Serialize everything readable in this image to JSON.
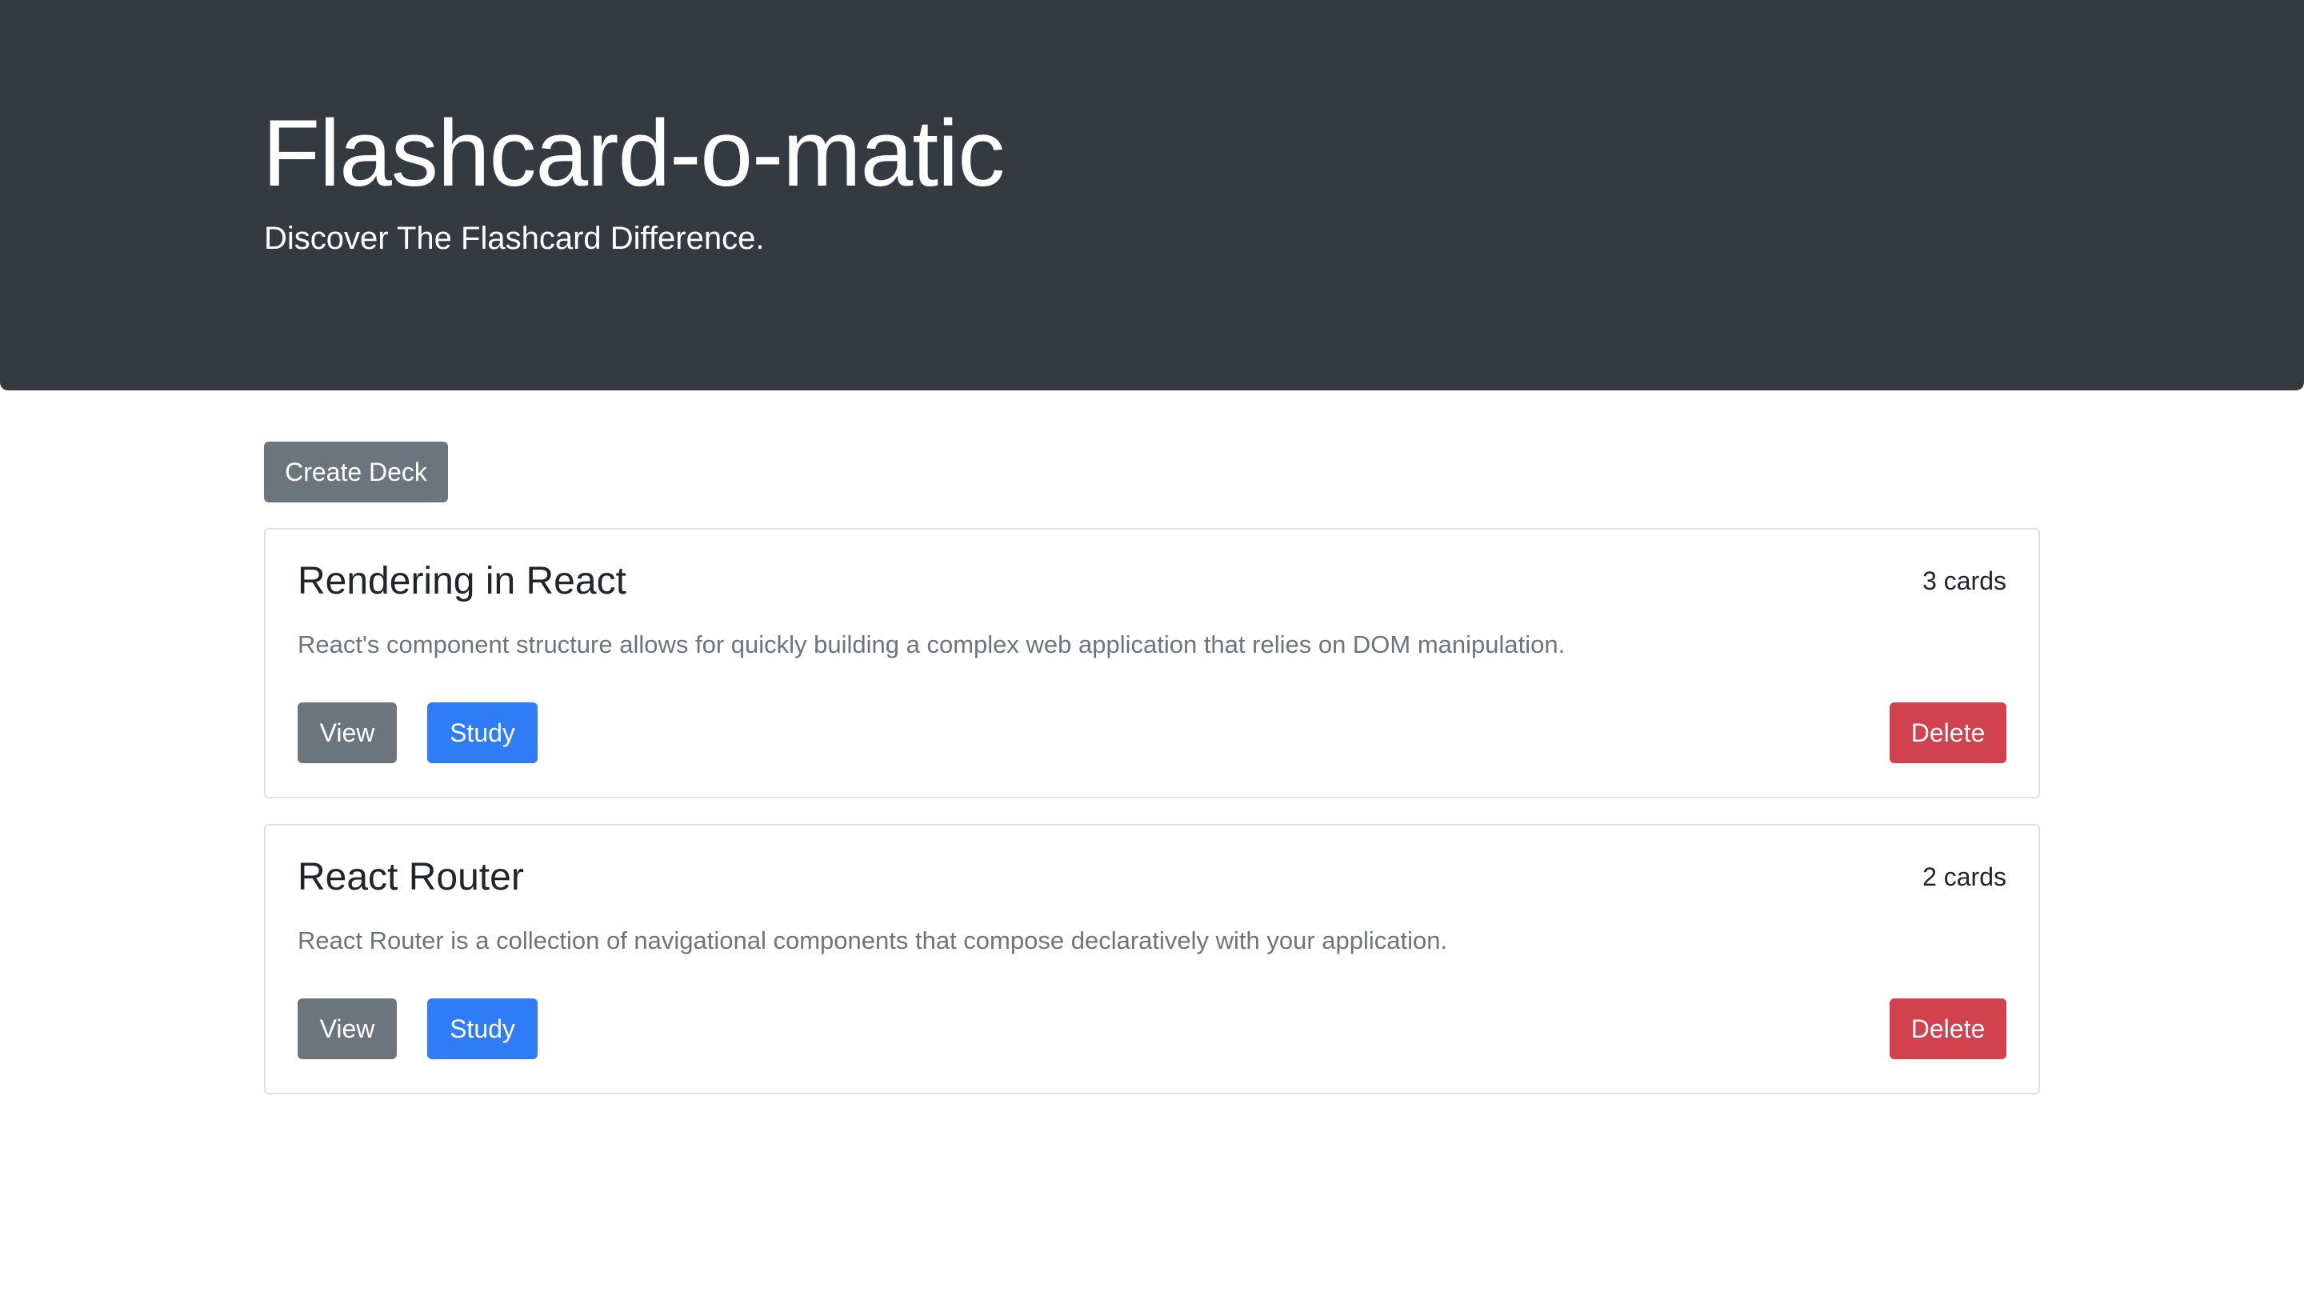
{
  "header": {
    "title": "Flashcard-o-matic",
    "subtitle": "Discover The Flashcard Difference."
  },
  "toolbar": {
    "create_label": "Create Deck"
  },
  "decks": [
    {
      "name": "Rendering in React",
      "count": "3 cards",
      "description": "React's component structure allows for quickly building a complex web application that relies on DOM manipulation.",
      "view_label": "View",
      "study_label": "Study",
      "delete_label": "Delete"
    },
    {
      "name": "React Router",
      "count": "2 cards",
      "description": "React Router is a collection of navigational components that compose declaratively with your application.",
      "view_label": "View",
      "study_label": "Study",
      "delete_label": "Delete"
    }
  ],
  "colors": {
    "header_bg": "#343a40",
    "secondary": "#6c757d",
    "primary": "#2f7cf6",
    "danger": "#d1414e"
  }
}
